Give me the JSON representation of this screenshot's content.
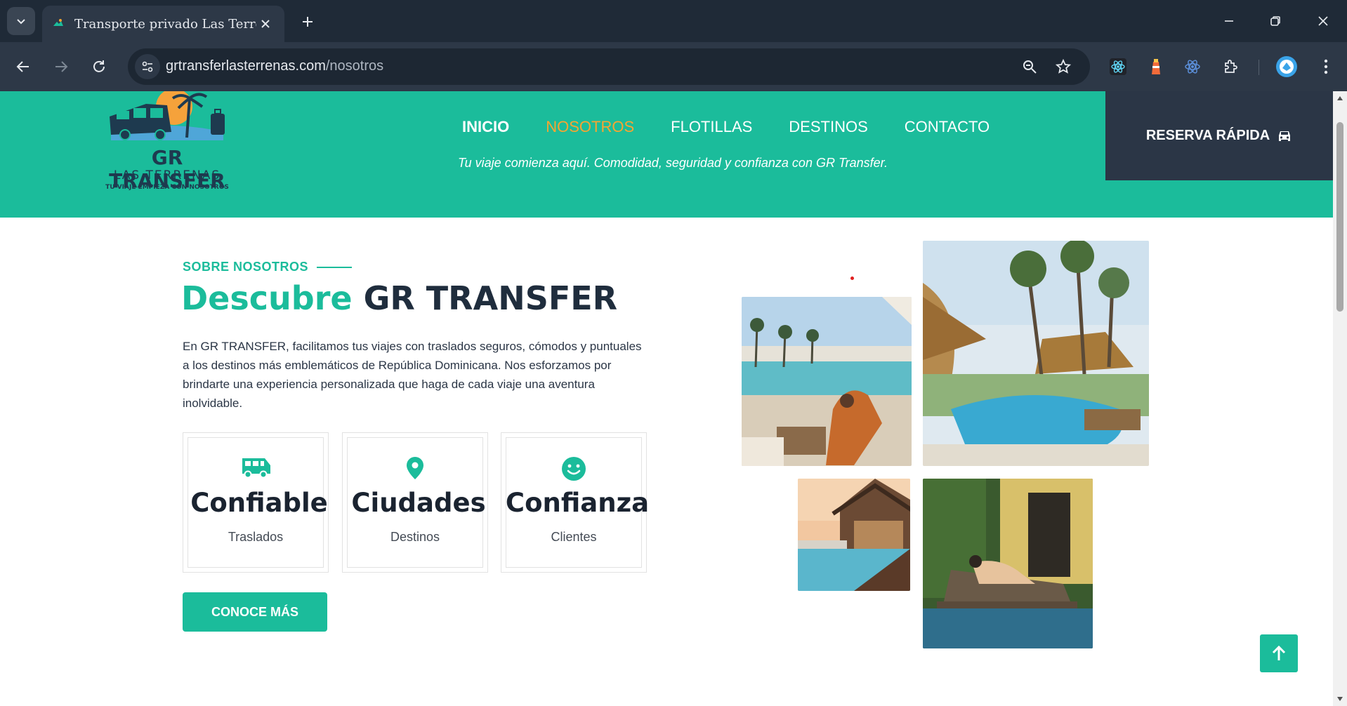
{
  "browser": {
    "tab_title": "Transporte privado Las Terrenas",
    "url_domain": "grtransferlasterrenas.com",
    "url_path": "/nosotros"
  },
  "header": {
    "logo": {
      "title": "GR TRANSFER",
      "subtitle": "LAS TERRENAS",
      "tagline": "TU VIAJE EMPIEZA CON NOSOTROS"
    },
    "nav": [
      {
        "label": "INICIO",
        "active": false
      },
      {
        "label": "NOSOTROS",
        "active": true
      },
      {
        "label": "FLOTILLAS",
        "active": false
      },
      {
        "label": "DESTINOS",
        "active": false
      },
      {
        "label": "CONTACTO",
        "active": false
      }
    ],
    "tagline": "Tu viaje comienza aquí. Comodidad, seguridad y confianza con GR Transfer.",
    "quick_booking": "RESERVA RÁPIDA"
  },
  "about": {
    "eyebrow": "SOBRE NOSOTROS",
    "headline_accent": "Descubre",
    "headline_main": "GR TRANSFER",
    "intro": "En GR TRANSFER, facilitamos tus viajes con traslados seguros, cómodos y puntuales a los destinos más emblemáticos de República Dominicana. Nos esforzamos por brindarte una experiencia personalizada que haga de cada viaje una aventura inolvidable.",
    "stats": [
      {
        "icon": "bus-icon",
        "title": "Confiable",
        "label": "Traslados"
      },
      {
        "icon": "map-pin-icon",
        "title": "Ciudades",
        "label": "Destinos"
      },
      {
        "icon": "smile-icon",
        "title": "Confianza",
        "label": "Clientes"
      }
    ],
    "cta": "CONOCE MÁS"
  },
  "colors": {
    "brand": "#1bbc9b",
    "active_nav": "#f7a531",
    "dark": "#2b3646"
  }
}
